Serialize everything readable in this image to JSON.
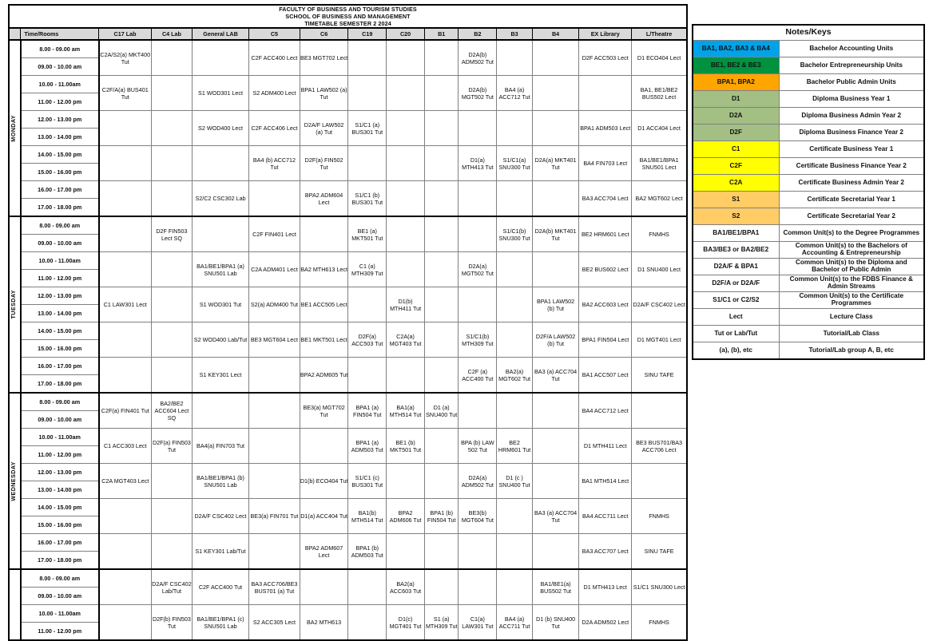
{
  "title": {
    "line1": "FACULTY OF BUSINESS AND TOURISM STUDIES",
    "line2": "SCHOOL OF BUSINESS AND MANAGEMENT",
    "line3": "TIMETABLE SEMESTER 2 2024"
  },
  "columns": [
    "Time/Rooms",
    "C17 Lab",
    "C4 Lab",
    "General LAB",
    "C5",
    "C6",
    "C19",
    "C20",
    "B1",
    "B2",
    "B3",
    "B4",
    "EX Library",
    "L/Theatre"
  ],
  "times": [
    "8.00 - 09.00 am",
    "09.00 - 10.00 am",
    "10.00 - 11.00am",
    "11.00 - 12.00 pm",
    "12.00 - 13.00 pm",
    "13.00 - 14.00 pm",
    "14.00 - 15.00 pm",
    "15.00 - 16.00 pm",
    "16.00 - 17.00 pm",
    "17.00 - 18.00 pm"
  ],
  "days": [
    {
      "name": "MONDAY",
      "slots": [
        {
          "cells": [
            "C2A/S2(a) MKT400  Tut",
            "",
            "",
            "C2F ACC400 Lect",
            "BE3 MGT702 Lect",
            "",
            "",
            "",
            "D2A(b) ADM502 Tut",
            "",
            "",
            "D2F ACC503 Lect",
            "D1 ECO404 Lect"
          ]
        },
        {
          "cells": [
            "C2F/A(a) BUS401 Tut",
            "",
            "S1 WOD301 Lect",
            "S2 ADM400 Lect",
            "BPA1    LAW502 (a)   Tut",
            "",
            "",
            "",
            "D2A(b) MGT502 Tut",
            "BA4 (a) ACC712 Tut",
            "",
            "",
            "BA1, BE1/BE2 BUS502 Lect"
          ]
        },
        {
          "cells": [
            "",
            "",
            "S2 WOD400 Lect",
            "C2F ACC406 Lect",
            "D2A/F LAW502 (a) Tut",
            "S1/C1 (a) BUS301 Tut",
            "",
            "",
            "",
            "",
            "",
            "BPA1 ADM503 Lect",
            "D1 ACC404   Lect"
          ]
        },
        {
          "cells": [
            "",
            "",
            "",
            "BA4 (b) ACC712 Tut",
            "D2F(a) FIN502 Tut",
            "",
            "",
            "",
            "D1(a) MTH413 Tut",
            "S1/C1(a) SNU300 Tut",
            "D2A(a) MKT401 Tut",
            "BA4 FIN703 Lect",
            "BA1/BE1/BPA1 SNU501  Lect"
          ]
        },
        {
          "cells": [
            "",
            "",
            "S2/C2 CSC302 Lab",
            "",
            "BPA2 ADM604 Lect",
            "S1/C1 (b) BUS301 Tut",
            "",
            "",
            "",
            "",
            "",
            "BA3 ACC704 Lect",
            "BA2 MGT602 Lect"
          ]
        }
      ]
    },
    {
      "name": "TUESDAY",
      "slots": [
        {
          "cells": [
            "",
            "D2F FIN503 Lect SQ",
            "",
            "C2F FIN401 Lect",
            "",
            "BE1 (a) MKT501 Tut",
            "",
            "",
            "",
            "S1/C1(b) SNU300 Tut",
            "D2A(b) MKT401 Tut",
            "BE2 HRM601 Lect",
            "FNMHS"
          ]
        },
        {
          "cells": [
            "",
            "",
            "BA1/BE1/BPA1 (a) SNU501  Lab",
            "C2A ADM401 Lect",
            "BA2 MTH613 Lect",
            "C1 (a) MTH309 Tut",
            "",
            "",
            "D2A(a) MGT502 Tut",
            "",
            "",
            "BE2 BUS602 Lect",
            "D1 SNU400 Lect"
          ]
        },
        {
          "cells": [
            "C1 LAW301 Lect",
            "",
            "S1 WOD301 Tut",
            "S2(a) ADM400 Tut",
            "BE1 ACC505 Lect",
            "",
            "D1(b) MTH411 Tut",
            "",
            "",
            "",
            "BPA1 LAW502 (b) Tut",
            "BA2 ACC603 Lect",
            "D2A/F CSC402 Lect"
          ]
        },
        {
          "cells": [
            "",
            "",
            "S2 WOD400 Lab/Tut",
            "BE3 MGT604 Lect",
            "BE1 MKT501 Lect",
            "D2F(a) ACC503 Tut",
            "C2A(a) MGT403 Tut",
            "",
            "S1/C1(b) MTH309 Tut",
            "",
            "D2F/A LAW502 (b) Tut",
            "BPA1 FIN504 Lect",
            "D1 MGT401 Lect"
          ]
        },
        {
          "cells": [
            "",
            "",
            "S1 KEY301  Lect",
            "",
            "BPA2 ADM605 Tut",
            "",
            "",
            "",
            "C2F (a) ACC400  Tut",
            "BA2(a) MGT602 Tut",
            "BA3 (a) ACC704 Tut",
            "BA1 ACC507 Lect",
            "SINU TAFE"
          ]
        }
      ]
    },
    {
      "name": "WEDNESDAY",
      "slots": [
        {
          "cells": [
            "C2F(a) FIN401  Tut",
            "BA2/BE2 ACC604  Lect SQ",
            "",
            "",
            "BE3(a) MGT702 Tut",
            "BPA1 (a) FIN504 Tut",
            "BA1(a) MTH514 Tut",
            "D1 (a) SNU400 Tut",
            "",
            "",
            "",
            "BA4 ACC712 Lect",
            ""
          ]
        },
        {
          "cells": [
            "C1 ACC303 Lect",
            "D2F(a) FIN503 Tut",
            "BA4(a) FIN703 Tut",
            "",
            "",
            "BPA1 (a) ADM503 Tut",
            "BE1 (b) MKT501 Tut",
            "",
            "BPA (b) LAW 502 Tut",
            "BE2 HRM601 Tut",
            "",
            "D1 MTH411 Lect",
            "BE3 BUS701/BA3 ACC706  Lect"
          ]
        },
        {
          "cells": [
            "C2A MGT403 Lect",
            "",
            "BA1/BE1/BPA1 (b) SNU501  Lab",
            "",
            "D1(b) ECO404 Tut",
            "S1/C1 (c) BUS301 Tut",
            "",
            "",
            "D2A(a) ADM502 Tut",
            "D1 (c ) SNU400 Tut",
            "",
            "BA1 MTH514 Lect",
            ""
          ]
        },
        {
          "cells": [
            "",
            "",
            "D2A/F CSC402 Lect",
            "BE3(a) FIN701 Tut",
            "D1(a) ACC404 Tut",
            "BA1(b) MTH514 Tut",
            "BPA2 ADM606 Tut",
            "BPA1 (b) FIN504 Tut",
            "BE3(b) MGT604 Tut",
            "",
            "BA3 (a) ACC704  Tut",
            "BA4 ACC711 Lect",
            "FNMHS"
          ]
        },
        {
          "cells": [
            "",
            "",
            "S1 KEY301 Lab/Tut",
            "",
            "BPA2 ADM607 Lect",
            "BPA1 (b) ADM503 Tut",
            "",
            "",
            "",
            "",
            "",
            "BA3 ACC707 Lect",
            "SINU TAFE"
          ]
        }
      ]
    },
    {
      "name": "",
      "slots": [
        {
          "cells": [
            "",
            "D2A/F CSC402 Lab/Tut",
            "C2F ACC400 Tut",
            "BA3 ACC706/BE3 BUS701 (a)  Tut",
            "",
            "",
            "BA2(a) ACC603 Tut",
            "",
            "",
            "",
            "BA1/BE1(a) BUS502 Tut",
            "D1 MTH413 Lect",
            "S1/C1 SNU300 Lect"
          ]
        },
        {
          "cells": [
            "",
            "D2F(b) FIN503  Tut",
            "BA1/BE1/BPA1 (c) SNU501  Lab",
            "S2 ACC305 Lect",
            "BA2 MTH613",
            "",
            "D1(c) MGT401 Tut",
            "S1 (a) MTH309 Tut",
            "C1(a) LAW301 Tut",
            "BA4 (a) ACC711 Tut",
            "D1 (b) SNU400 Tut",
            "D2A ADM502 Lect",
            "FNMHS"
          ]
        }
      ]
    }
  ],
  "legend": {
    "title": "Notes/Keys",
    "rows": [
      {
        "code": "BA1, BA2, BA3 & BA4",
        "desc": "Bachelor Accounting Units",
        "color": "#00a2e8"
      },
      {
        "code": "BE1, BE2 & BE3",
        "desc": "Bachelor Entrepreneurship Units",
        "color": "#00923f"
      },
      {
        "code": "BPA1, BPA2",
        "desc": "Bachelor Public Admin Units",
        "color": "#ffa500"
      },
      {
        "code": "D1",
        "desc": "Diploma Business Year 1",
        "color": "#a3bf84"
      },
      {
        "code": "D2A",
        "desc": "Diploma Business Admin Year 2",
        "color": "#a3bf84"
      },
      {
        "code": "D2F",
        "desc": "Diploma Business Finance Year 2",
        "color": "#a3bf84"
      },
      {
        "code": "C1",
        "desc": "Certificate Business Year 1",
        "color": "#ffff00"
      },
      {
        "code": "C2F",
        "desc": "Certificate Business Finance Year 2",
        "color": "#ffff00"
      },
      {
        "code": "C2A",
        "desc": "Certificate Business Admin Year 2",
        "color": "#ffff00"
      },
      {
        "code": "S1",
        "desc": "Certificate Secretarial Year 1",
        "color": "#ffcc66"
      },
      {
        "code": "S2",
        "desc": "Certificate Secretarial Year 2",
        "color": "#ffcc66"
      },
      {
        "code": "BA1/BE1/BPA1",
        "desc": "Common Unit(s) to the Degree Programmes",
        "color": "#ffffff"
      },
      {
        "code": "BA3/BE3 or BA2/BE2",
        "desc": "Common Unit(s) to the Bachelors of Accounting & Entrepreneurship",
        "color": "#ffffff"
      },
      {
        "code": "D2A/F & BPA1",
        "desc": "Common Unit(s) to the Diploma and Bachelor of Public Admin",
        "color": "#ffffff"
      },
      {
        "code": "D2F/A or D2A/F",
        "desc": "Common Unit(s) to the FDBS Finance & Admin Streams",
        "color": "#ffffff"
      },
      {
        "code": "S1/C1 or C2/S2",
        "desc": "Common Unit(s) to the Certificate Programmes",
        "color": "#ffffff"
      },
      {
        "code": "Lect",
        "desc": "Lecture Class",
        "color": "#ffffff"
      },
      {
        "code": "Tut or Lab/Tut",
        "desc": "Tutorial/Lab Class",
        "color": "#ffffff"
      },
      {
        "code": "(a), (b), etc",
        "desc": "Tutorial/Lab group A, B, etc",
        "color": "#ffffff"
      }
    ]
  }
}
